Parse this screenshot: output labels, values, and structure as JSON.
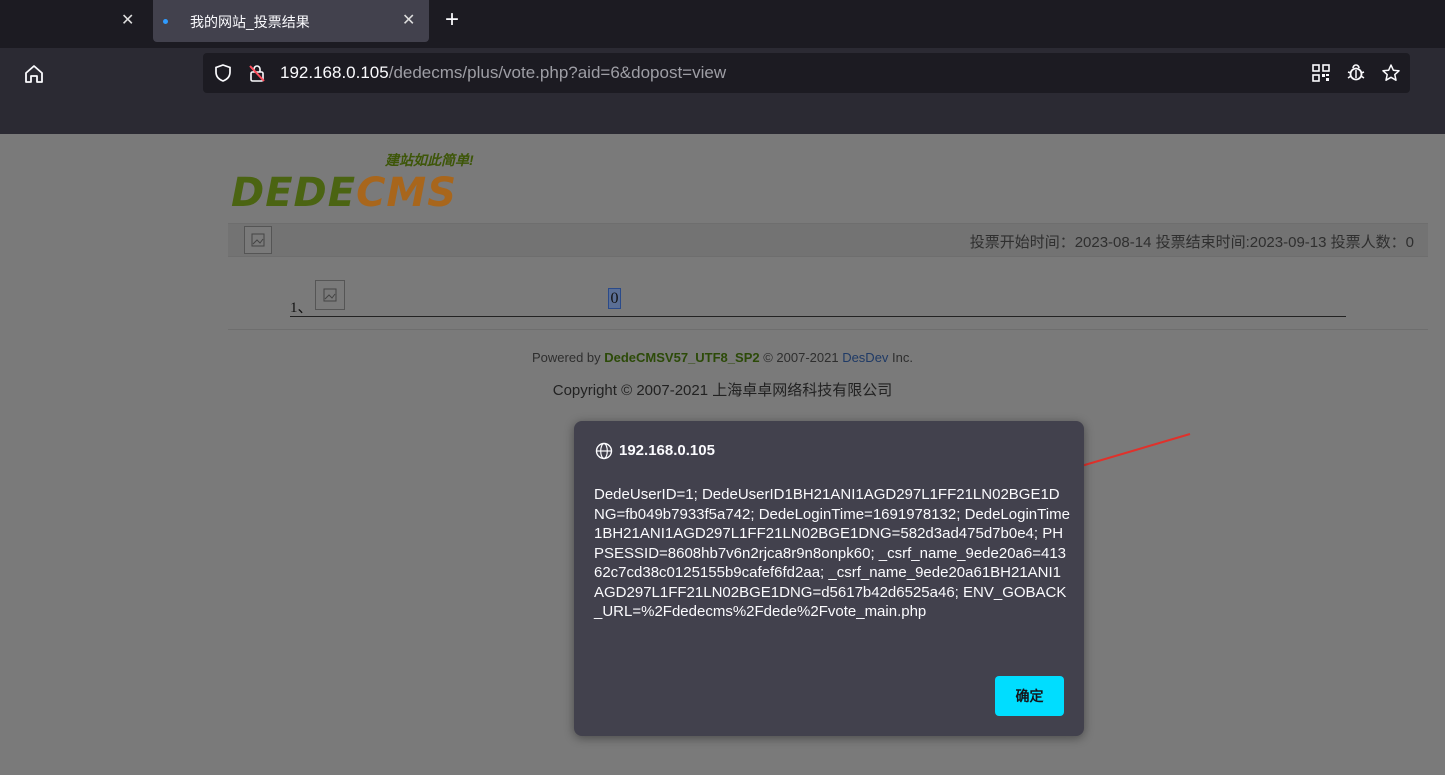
{
  "browser": {
    "active_tab_title": "我的网站_投票结果",
    "url_host": "192.168.0.105",
    "url_path": "/dedecms/plus/vote.php?aid=6&dopost=view",
    "icons": [
      "close-icon",
      "plus-icon",
      "home-icon",
      "shield-icon",
      "insecure-lock-icon",
      "qr-code-icon",
      "bug-icon",
      "star-icon"
    ],
    "colors": {
      "chrome": "#1c1b22",
      "toolbar": "#2b2a33",
      "accent": "#00ddff"
    }
  },
  "site": {
    "logo_text_a": "DEDE",
    "logo_text_b": "CMS",
    "logo_slogan": "建站如此简单!",
    "vote_info": "投票开始时间：2023-08-14   投票结束时间:2023-09-13 投票人数：0",
    "rows": [
      {
        "index": "1、",
        "value": "0"
      }
    ],
    "powered_prefix": "Powered by ",
    "powered_product": "DedeCMSV57_UTF8_SP2",
    "powered_mid": " © 2007-2021 ",
    "powered_dev": "DesDev",
    "powered_suffix": " Inc.",
    "copyright": "Copyright © 2007-2021 上海卓卓网络科技有限公司"
  },
  "dialog": {
    "host": "192.168.0.105",
    "message": "DedeUserID=1; DedeUserID1BH21ANI1AGD297L1FF21LN02BGE1DNG=fb049b7933f5a742; DedeLoginTime=1691978132; DedeLoginTime1BH21ANI1AGD297L1FF21LN02BGE1DNG=582d3ad475d7b0e4; PHPSESSID=8608hb7v6n2rjca8r9n8onpk60; _csrf_name_9ede20a6=41362c7cd38c0125155b9cafef6fd2aa; _csrf_name_9ede20a61BH21ANI1AGD297L1FF21LN02BGE1DNG=d5617b42d6525a46; ENV_GOBACK_URL=%2Fdedecms%2Fdede%2Fvote_main.php",
    "ok_label": "确定"
  }
}
